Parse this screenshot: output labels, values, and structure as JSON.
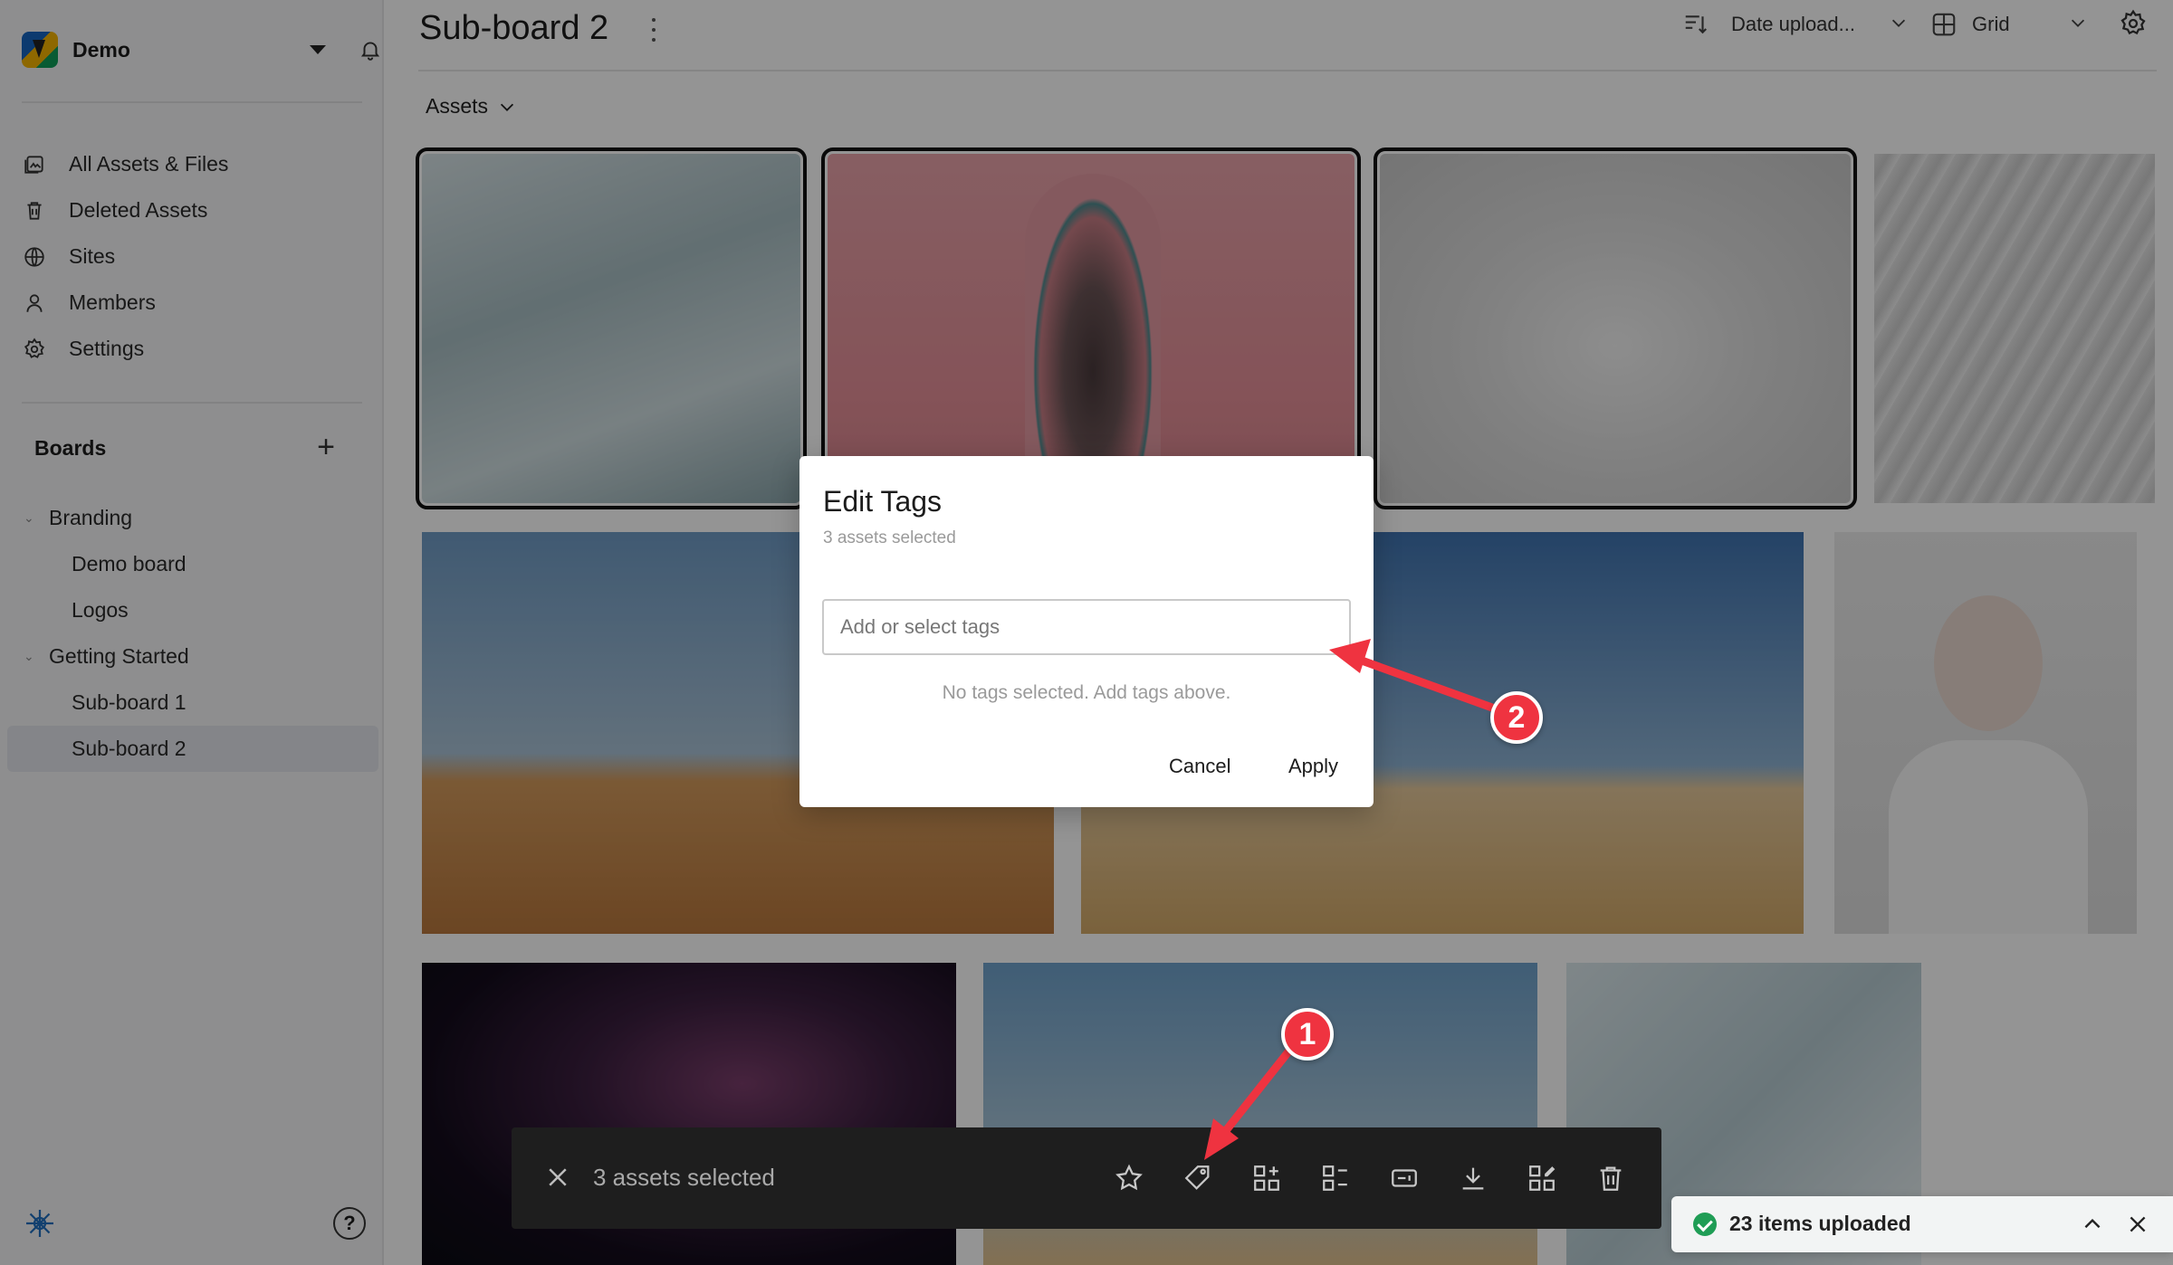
{
  "workspace": {
    "name": "Demo"
  },
  "nav": {
    "items": [
      {
        "label": "All Assets & Files",
        "icon": "all-assets-icon"
      },
      {
        "label": "Deleted Assets",
        "icon": "trash-icon"
      },
      {
        "label": "Sites",
        "icon": "globe-icon"
      },
      {
        "label": "Members",
        "icon": "user-icon"
      },
      {
        "label": "Settings",
        "icon": "gear-icon"
      }
    ]
  },
  "boards": {
    "title": "Boards",
    "tree": [
      {
        "label": "Branding",
        "level": 1,
        "expanded": true
      },
      {
        "label": "Demo board",
        "level": 2
      },
      {
        "label": "Logos",
        "level": 2
      },
      {
        "label": "Getting Started",
        "level": 1,
        "expanded": true
      },
      {
        "label": "Sub-board 1",
        "level": 2
      },
      {
        "label": "Sub-board 2",
        "level": 2,
        "active": true
      }
    ]
  },
  "header": {
    "title": "Sub-board 2",
    "sort_label": "Date upload...",
    "view_label": "Grid",
    "assets_dropdown": "Assets"
  },
  "modal": {
    "title": "Edit Tags",
    "subtitle": "3 assets selected",
    "input_placeholder": "Add or select tags",
    "empty_message": "No tags selected. Add tags above.",
    "cancel_label": "Cancel",
    "apply_label": "Apply"
  },
  "selection_bar": {
    "count_label": "3 assets selected",
    "actions": [
      "star-icon",
      "tag-icon",
      "add-to-board-icon",
      "board-list-icon",
      "rename-icon",
      "download-icon",
      "edit-boards-icon",
      "delete-icon"
    ]
  },
  "toast": {
    "text": "23 items uploaded",
    "status_color": "#1f9d55"
  },
  "annotations": {
    "step1": "1",
    "step2": "2",
    "color": "#ef3340"
  }
}
